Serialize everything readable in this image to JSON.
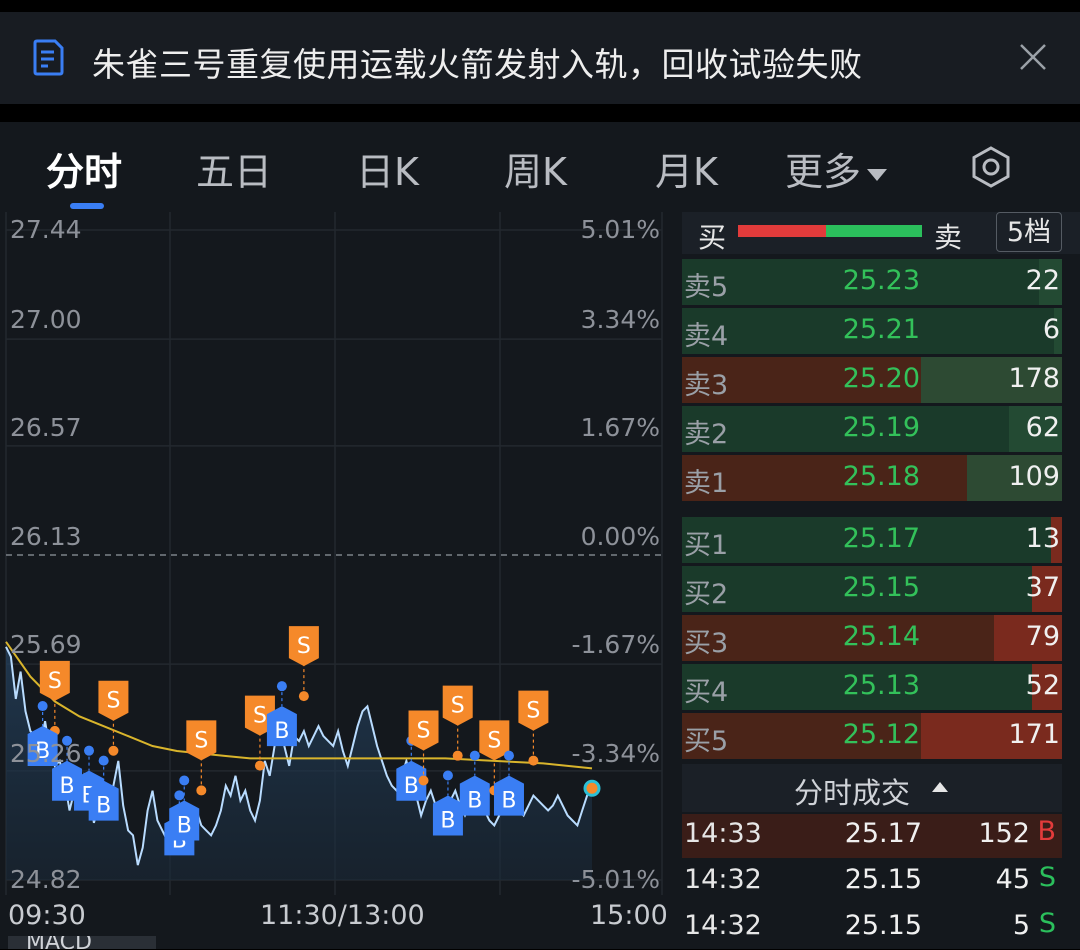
{
  "banner": {
    "text": "朱雀三号重复使用运载火箭发射入轨，回收试验失败",
    "icon": "document-icon",
    "close_icon": "close-icon"
  },
  "tabs": [
    {
      "label": "分时",
      "active": true
    },
    {
      "label": "五日",
      "active": false
    },
    {
      "label": "日K",
      "active": false
    },
    {
      "label": "周K",
      "active": false
    },
    {
      "label": "月K",
      "active": false
    },
    {
      "label": "更多",
      "active": false
    }
  ],
  "settings_icon": "settings-icon",
  "colors": {
    "up": "#e23b3b",
    "down": "#2bbf5c",
    "price_line": "#b9dcff",
    "avg_line": "#d9b52c",
    "buy_marker": "#3a7ef4",
    "sell_marker": "#f5892a",
    "panel_bg": "#14181d"
  },
  "chart_data": {
    "type": "line",
    "y_price_labels": [
      "27.44",
      "27.00",
      "26.57",
      "26.13",
      "25.69",
      "25.26",
      "24.82"
    ],
    "y_pct_labels": [
      "5.01%",
      "3.34%",
      "1.67%",
      "0.00%",
      "-1.67%",
      "-3.34%",
      "-5.01%"
    ],
    "x_labels": [
      "09:30",
      "11:30/13:00",
      "15:00"
    ],
    "prev_close": 26.13,
    "ylim": [
      24.82,
      27.44
    ],
    "series": [
      {
        "name": "price",
        "x": [
          0,
          2,
          4,
          6,
          8,
          10,
          12,
          14,
          16,
          18,
          20,
          22,
          24,
          26,
          28,
          30,
          32,
          34,
          36,
          38,
          40,
          42,
          44,
          46,
          48,
          50,
          52,
          54,
          56,
          58,
          60,
          62,
          64,
          66,
          68,
          70,
          72,
          74,
          76,
          78,
          80,
          82,
          84,
          86,
          88,
          90,
          92,
          94,
          96,
          98,
          100,
          102,
          104,
          106,
          108,
          110,
          112,
          114,
          116,
          118,
          120,
          122,
          124,
          126,
          128,
          130,
          132,
          134,
          136,
          138,
          140,
          142,
          144,
          146,
          148,
          150,
          152,
          154,
          156,
          158,
          160,
          162,
          164,
          166,
          168,
          170,
          172,
          174,
          176,
          178,
          180,
          182,
          184,
          186,
          188,
          190,
          192,
          194,
          196,
          198,
          200,
          202,
          204,
          206,
          208,
          210,
          212,
          214,
          216,
          218,
          220,
          222,
          224,
          226,
          228,
          230,
          232,
          234,
          236,
          238,
          240
        ],
        "values": [
          25.76,
          25.72,
          25.55,
          25.66,
          25.5,
          25.42,
          25.4,
          25.36,
          25.46,
          25.34,
          25.28,
          25.3,
          25.22,
          25.1,
          25.18,
          25.16,
          25.24,
          25.18,
          25.05,
          25.12,
          25.14,
          25.08,
          25.2,
          25.3,
          25.12,
          25.02,
          25.0,
          24.88,
          24.95,
          25.1,
          25.18,
          25.06,
          25.02,
          24.98,
          25.08,
          25.0,
          25.06,
          25.02,
          25.08,
          25.1,
          25.04,
          25.02,
          25.0,
          25.04,
          25.1,
          25.2,
          25.16,
          25.24,
          25.14,
          25.18,
          25.1,
          25.06,
          25.14,
          25.3,
          25.24,
          25.36,
          25.44,
          25.36,
          25.28,
          25.4,
          25.38,
          25.42,
          25.36,
          25.4,
          25.44,
          25.4,
          25.38,
          25.36,
          25.42,
          25.34,
          25.28,
          25.36,
          25.44,
          25.5,
          25.52,
          25.44,
          25.36,
          25.3,
          25.24,
          25.2,
          25.18,
          25.24,
          25.3,
          25.22,
          25.16,
          25.08,
          25.14,
          25.18,
          25.12,
          25.04,
          25.08,
          25.14,
          25.18,
          25.12,
          25.08,
          25.12,
          25.16,
          25.14,
          25.1,
          25.06,
          25.04,
          25.08,
          25.12,
          25.16,
          25.14,
          25.1,
          25.08,
          25.12,
          25.16,
          25.14,
          25.12,
          25.1,
          25.12,
          25.16,
          25.12,
          25.08,
          25.06,
          25.04,
          25.1,
          25.16,
          25.19
        ]
      },
      {
        "name": "avg",
        "x": [
          0,
          10,
          20,
          30,
          40,
          50,
          60,
          70,
          80,
          90,
          100,
          120,
          140,
          160,
          180,
          200,
          220,
          240
        ],
        "values": [
          25.78,
          25.64,
          25.54,
          25.48,
          25.44,
          25.4,
          25.36,
          25.34,
          25.33,
          25.32,
          25.31,
          25.31,
          25.31,
          25.31,
          25.31,
          25.3,
          25.29,
          25.27
        ]
      }
    ],
    "trade_markers": [
      {
        "label": "S",
        "x": 20
      },
      {
        "label": "B",
        "x": 15
      },
      {
        "label": "B",
        "x": 25
      },
      {
        "label": "B",
        "x": 34
      },
      {
        "label": "B",
        "x": 40
      },
      {
        "label": "S",
        "x": 44
      },
      {
        "label": "B",
        "x": 71
      },
      {
        "label": "B",
        "x": 73
      },
      {
        "label": "S",
        "x": 80
      },
      {
        "label": "S",
        "x": 104
      },
      {
        "label": "B",
        "x": 113
      },
      {
        "label": "S",
        "x": 122
      },
      {
        "label": "B",
        "x": 166
      },
      {
        "label": "S",
        "x": 171
      },
      {
        "label": "B",
        "x": 181
      },
      {
        "label": "S",
        "x": 185
      },
      {
        "label": "B",
        "x": 192
      },
      {
        "label": "S",
        "x": 200
      },
      {
        "label": "B",
        "x": 206
      },
      {
        "label": "S",
        "x": 216
      }
    ]
  },
  "order_book": {
    "buy_label": "买",
    "sell_label": "卖",
    "levels_button": "5档",
    "asks": [
      {
        "label": "卖5",
        "price": "25.23",
        "vol": "22",
        "fill": 0.06,
        "bg": "#1a3a2a"
      },
      {
        "label": "卖4",
        "price": "25.21",
        "vol": "6",
        "fill": 0.02,
        "bg": "#1a3a2a"
      },
      {
        "label": "卖3",
        "price": "25.20",
        "vol": "178",
        "fill": 0.37,
        "bg": "#4a2418"
      },
      {
        "label": "卖2",
        "price": "25.19",
        "vol": "62",
        "fill": 0.14,
        "bg": "#1a3a2a"
      },
      {
        "label": "卖1",
        "price": "25.18",
        "vol": "109",
        "fill": 0.25,
        "bg": "#4a2418"
      }
    ],
    "bids": [
      {
        "label": "买1",
        "price": "25.17",
        "vol": "13",
        "fill": 0.03,
        "bg": "#1a3a2a"
      },
      {
        "label": "买2",
        "price": "25.15",
        "vol": "37",
        "fill": 0.08,
        "bg": "#1a3a2a"
      },
      {
        "label": "买3",
        "price": "25.14",
        "vol": "79",
        "fill": 0.18,
        "bg": "#4a2418"
      },
      {
        "label": "买4",
        "price": "25.13",
        "vol": "52",
        "fill": 0.08,
        "bg": "#1a3a2a"
      },
      {
        "label": "买5",
        "price": "25.12",
        "vol": "171",
        "fill": 0.37,
        "bg": "#4a2418"
      }
    ]
  },
  "trades": {
    "title": "分时成交",
    "rows": [
      {
        "time": "14:33",
        "price": "25.17",
        "vol": "152",
        "side": "B"
      },
      {
        "time": "14:32",
        "price": "25.15",
        "vol": "45",
        "side": "S"
      },
      {
        "time": "14:32",
        "price": "25.15",
        "vol": "5",
        "side": "S"
      }
    ]
  },
  "macd_label": "MACD"
}
